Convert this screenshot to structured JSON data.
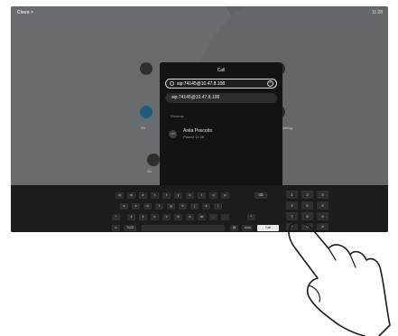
{
  "status_bar": {
    "brand": "Cisco >",
    "time": "11:28"
  },
  "dialog": {
    "title": "Call",
    "input_value": "sip:74145@10.47.8.108",
    "suggestion": "sip:74145@10.47.8.108",
    "recents_label": "Recents",
    "recent": {
      "avatar_initials": "AP",
      "name": "Anita Poscotto",
      "meta": "Placed 11:28"
    }
  },
  "background_labels": {
    "left": "Sh",
    "right": "eeting",
    "lower": "Sh"
  },
  "keyboard": {
    "row1": [
      "q",
      "w",
      "e",
      "r",
      "t",
      "y",
      "u",
      "i",
      "o",
      "p"
    ],
    "row2": [
      "a",
      "s",
      "d",
      "f",
      "g",
      "h",
      "j",
      "k",
      "l"
    ],
    "row3": [
      "z",
      "x",
      "c",
      "v",
      "b",
      "n",
      "m",
      ",",
      "."
    ],
    "row4": {
      "symbols": "?123",
      "at": "@",
      "dotcom": ".com",
      "call": "Call"
    },
    "numpad": [
      "1",
      "2",
      "3",
      "4",
      "5",
      "6",
      "7",
      "8",
      "9",
      "*",
      "0",
      "#"
    ]
  },
  "icons": {
    "backspace": "backspace-icon",
    "shift": "shift-icon",
    "hide": "hide-keyboard-icon",
    "search": "search-icon",
    "clear": "clear-icon",
    "arrow": "arrow-right-icon"
  },
  "colors": {
    "screen": "#5f6366",
    "dialog": "#121314",
    "keyboard": "#1b1c1d",
    "call_key": "#e9e9e9"
  }
}
